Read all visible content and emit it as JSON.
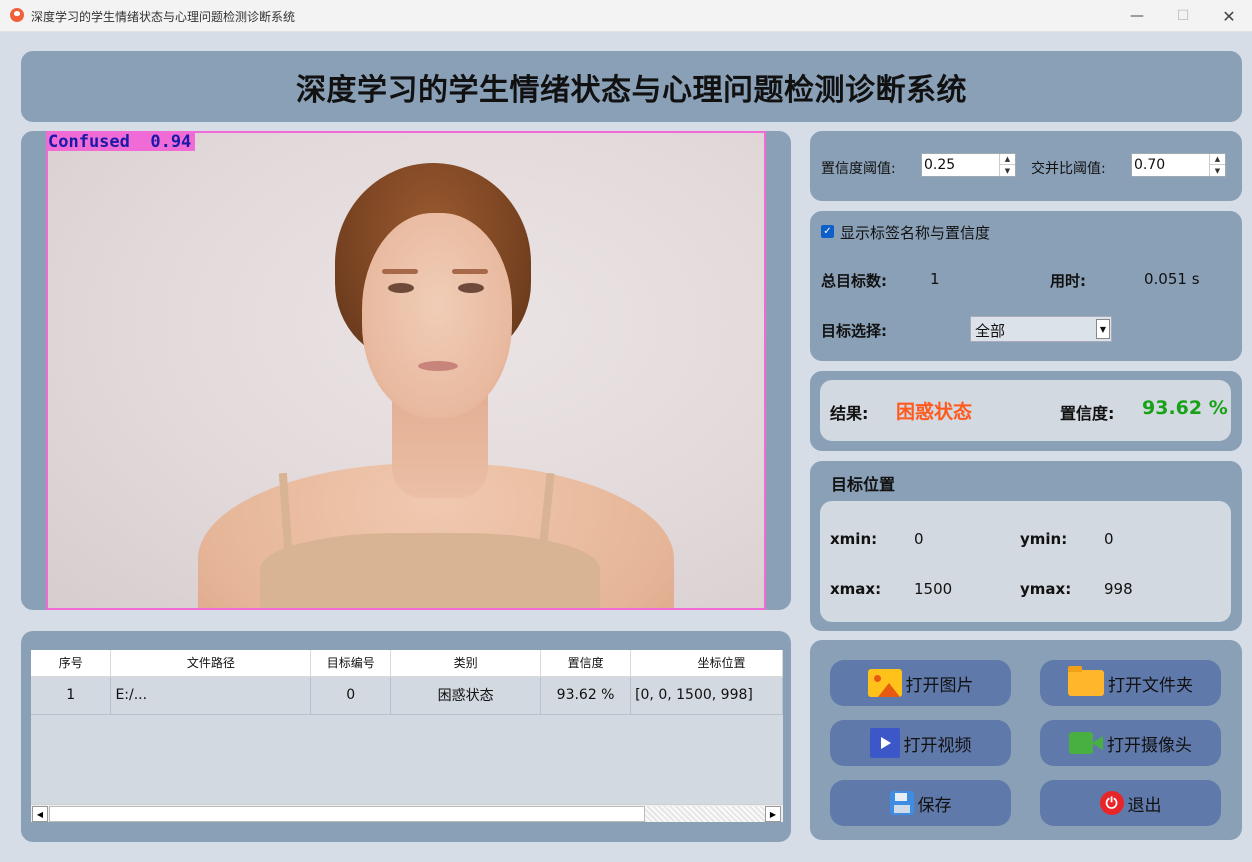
{
  "window": {
    "title": "深度学习的学生情绪状态与心理问题检测诊断系统",
    "controls": [
      "minimize",
      "maximize",
      "close"
    ]
  },
  "header": {
    "title": "深度学习的学生情绪状态与心理问题检测诊断系统"
  },
  "image_view": {
    "detection_label": "Confused  0.94",
    "box_color": "#f06bd6",
    "label_text_color": "#1a1aa8"
  },
  "thresholds": {
    "confidence_label": "置信度阈值:",
    "confidence_value": "0.25",
    "iou_label": "交并比阈值:",
    "iou_value": "0.70"
  },
  "info": {
    "show_labels_text": "显示标签名称与置信度",
    "show_labels_checked": true,
    "total_targets_label": "总目标数:",
    "total_targets_value": "1",
    "time_label": "用时:",
    "time_value": "0.051 s",
    "target_select_label": "目标选择:",
    "target_select_value": "全部"
  },
  "result": {
    "label": "结果:",
    "value": "困惑状态",
    "value_color": "#ff5a1e",
    "confidence_label": "置信度:",
    "confidence_value": "93.62 %",
    "confidence_color": "#18a218"
  },
  "position": {
    "title": "目标位置",
    "xmin_label": "xmin:",
    "xmin_value": "0",
    "ymin_label": "ymin:",
    "ymin_value": "0",
    "xmax_label": "xmax:",
    "xmax_value": "1500",
    "ymax_label": "ymax:",
    "ymax_value": "998"
  },
  "actions": {
    "open_image": "打开图片",
    "open_folder": "打开文件夹",
    "open_video": "打开视频",
    "open_camera": "打开摄像头",
    "save": "保存",
    "exit": "退出"
  },
  "table": {
    "headers": [
      "序号",
      "文件路径",
      "目标编号",
      "类别",
      "置信度",
      "坐标位置"
    ],
    "rows": [
      [
        "1",
        "E:/...",
        "0",
        "困惑状态",
        "93.62 %",
        "[0, 0, 1500, 998]"
      ]
    ]
  },
  "colors": {
    "panel": "#8aa0b7",
    "background": "#d6dde6",
    "button": "#5f79aa"
  }
}
